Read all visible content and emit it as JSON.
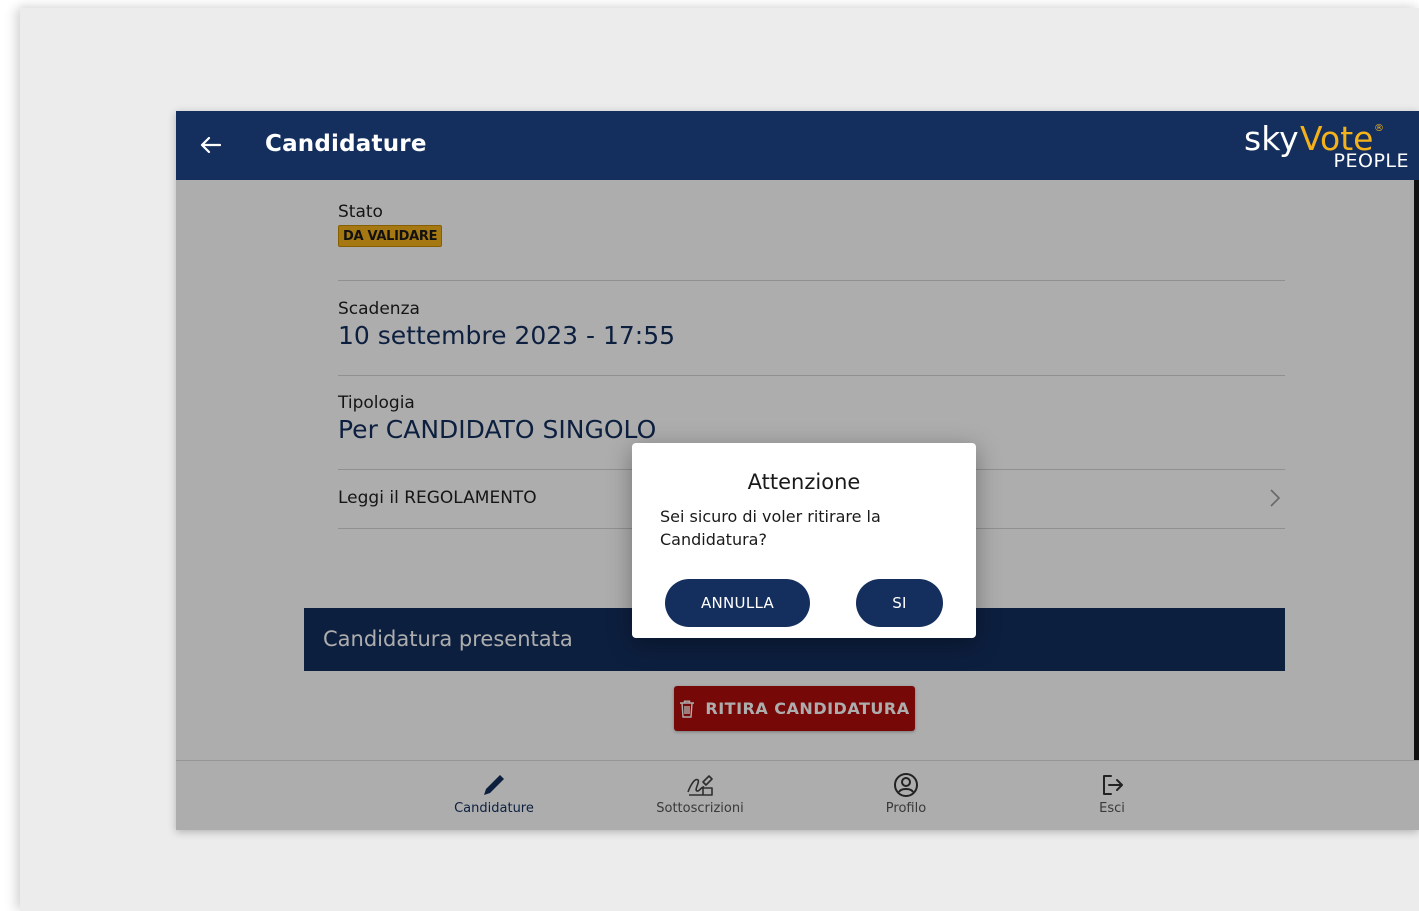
{
  "appbar": {
    "title": "Candidature",
    "brand": {
      "part1": "sky",
      "part2": "Vote",
      "registered": "®",
      "sub": "PEOPLE"
    }
  },
  "details": {
    "stato_label": "Stato",
    "stato_badge": "DA VALIDARE",
    "scadenza_label": "Scadenza",
    "scadenza_value": "10 settembre 2023 - 17:55",
    "tipologia_label": "Tipologia",
    "tipologia_value": "Per CANDIDATO SINGOLO",
    "regolamento_link": "Leggi il REGOLAMENTO"
  },
  "present_band": {
    "label": "Candidatura presentata"
  },
  "ritira_button": {
    "label": "RITIRA CANDIDATURA"
  },
  "bottom_nav": {
    "items": [
      {
        "label": "Candidature",
        "icon": "pencil-icon",
        "active": true
      },
      {
        "label": "Sottoscrizioni",
        "icon": "signature-icon",
        "active": false
      },
      {
        "label": "Profilo",
        "icon": "user-circle-icon",
        "active": false
      },
      {
        "label": "Esci",
        "icon": "logout-icon",
        "active": false
      }
    ]
  },
  "dialog": {
    "title": "Attenzione",
    "message": "Sei sicuro di voler ritirare la Candidatura?",
    "cancel_label": "ANNULLA",
    "confirm_label": "SI"
  },
  "colors": {
    "primary": "#142f5e",
    "badge": "#f4b21a",
    "danger": "#b00d0d",
    "brand_accent": "#f4b21a"
  }
}
